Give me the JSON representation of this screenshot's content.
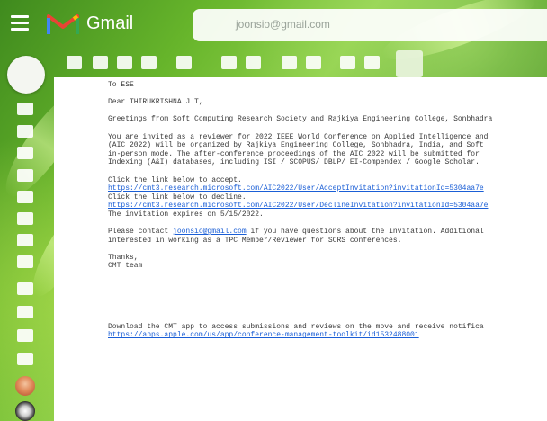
{
  "header": {
    "brand": "Gmail",
    "search_value": "joonsio@gmail.com"
  },
  "colors": {
    "link": "#1a5ed6",
    "gmail_red": "#ea4335"
  },
  "icons": {
    "menu": "hamburger-menu-icon",
    "logo": "gmail-logo-icon"
  },
  "email": {
    "to_line": "To ESE",
    "greeting": "Dear THIRUKRISHNA J T,",
    "intro": "Greetings from Soft Computing Research Society and Rajkiya Engineering College, Sonbhadra",
    "body_lines": [
      "You are invited as a reviewer for 2022 IEEE World Conference on Applied Intelligence and",
      "(AIC 2022) will be organized by Rajkiya Engineering College, Sonbhadra, India, and Soft",
      "in-person mode. The after-conference proceedings of the AIC 2022 will be submitted for",
      "Indexing (A&I) databases, including ISI / SCOPUS/ DBLP/ EI-Compendex / Google Scholar."
    ],
    "accept_label": "Click the link below to accept.",
    "accept_link": "https://cmt3.research.microsoft.com/AIC2022/User/AcceptInvitation?invitationId=5304aa7e",
    "decline_label": "Click the link below to decline.",
    "decline_link": "https://cmt3.research.microsoft.com/AIC2022/User/DeclineInvitation?invitationId=5304aa7e",
    "expiry": "The invitation expires on 5/15/2022.",
    "contact_pre": "Please contact ",
    "contact_email": "joonsio@gmail.com",
    "contact_post": " if you have questions about the invitation. Additional",
    "contact_line2": "interested in working as a TPC Member/Reviewer for SCRS conferences.",
    "thanks": "Thanks,",
    "signature": "CMT team",
    "download": "Download the CMT app to access submissions and reviews on the move and receive notifica",
    "download_link": "https://apps.apple.com/us/app/conference-management-toolkit/id1532488001"
  }
}
